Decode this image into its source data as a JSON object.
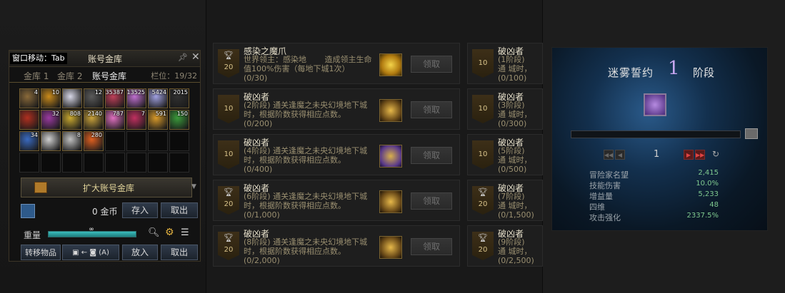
{
  "storage": {
    "move_tab": "窗口移动：Tab",
    "title": "账号金库",
    "pin_icon": "pin-icon",
    "tabs": [
      "金库 1",
      "金库 2",
      "账号金库"
    ],
    "active_tab": 2,
    "slots": "栏位：19/32",
    "items": [
      {
        "count": "4",
        "color": "#8a6a3a"
      },
      {
        "count": "10",
        "color": "#c98a1a"
      },
      {
        "count": "",
        "color": "#d6d6e6"
      },
      {
        "count": "12",
        "color": "#5a5a5a"
      },
      {
        "count": "35387",
        "color": "#c0405a"
      },
      {
        "count": "13525",
        "color": "#c070d0"
      },
      {
        "count": "5424",
        "color": "#a0a0e0"
      },
      {
        "count": "2015",
        "color": "#303030"
      },
      {
        "count": "",
        "color": "#b03020"
      },
      {
        "count": "32",
        "color": "#9a3aa0"
      },
      {
        "count": "808",
        "color": "#c8a830"
      },
      {
        "count": "2140",
        "color": "#c9a23a"
      },
      {
        "count": "787",
        "color": "#e070c0"
      },
      {
        "count": "7",
        "color": "#c03060"
      },
      {
        "count": "591",
        "color": "#d89a2a"
      },
      {
        "count": "150",
        "color": "#3a9a3a"
      },
      {
        "count": "34",
        "color": "#3a6ac0"
      },
      {
        "count": "",
        "color": "#d0d0d0"
      },
      {
        "count": "8",
        "color": "#c0c0c0"
      },
      {
        "count": "280",
        "color": "#e06020"
      }
    ],
    "expand_label": "扩大账号金库",
    "gold_text": "0 金币",
    "deposit": "存入",
    "withdraw": "取出",
    "weight_label": "重量",
    "weight_value": "∞",
    "weight_fill": 1.0,
    "transfer_label": "转移物品",
    "transfer_hint": "(A)",
    "put_in": "放入",
    "take_out": "取出"
  },
  "rows_left": [
    {
      "badge": "20",
      "trophy": true,
      "title": "感染之魔爪",
      "desc": "世界领主：感染地 　　造成领主生命值100%伤害（每地下城1次）",
      "progress": "(0/30)",
      "reward": "gold",
      "claim": "领取"
    },
    {
      "badge": "10",
      "trophy": false,
      "title": "破凶者",
      "desc": "(2阶段) 通关逢魔之未央幻境地下城时，根据阶数获得相应点数。",
      "progress": "(0/200)",
      "reward": "emblem",
      "claim": "领取"
    },
    {
      "badge": "10",
      "trophy": false,
      "title": "破凶者",
      "desc": "(4阶段) 通关逢魔之未央幻境地下城时，根据阶数获得相应点数。",
      "progress": "(0/400)",
      "reward": "emblem-purple",
      "claim": "领取"
    },
    {
      "badge": "20",
      "trophy": true,
      "title": "破凶者",
      "desc": "(6阶段) 通关逢魔之未央幻境地下城时，根据阶数获得相应点数。",
      "progress": "(0/1,000)",
      "reward": "emblem",
      "claim": "领取"
    },
    {
      "badge": "20",
      "trophy": true,
      "title": "破凶者",
      "desc": "(8阶段) 通关逢魔之未央幻境地下城时，根据阶数获得相应点数。",
      "progress": "(0/2,000)",
      "reward": "emblem",
      "claim": "领取"
    }
  ],
  "rows_right": [
    {
      "badge": "10",
      "trophy": false,
      "title": "破凶者",
      "desc": "(1阶段) 通 城时，根据",
      "progress": "(0/100)"
    },
    {
      "badge": "10",
      "trophy": false,
      "title": "破凶者",
      "desc": "(3阶段) 通 城时，根据",
      "progress": "(0/300)"
    },
    {
      "badge": "10",
      "trophy": false,
      "title": "破凶者",
      "desc": "(5阶段) 通 城时，根据",
      "progress": "(0/500)"
    },
    {
      "badge": "20",
      "trophy": true,
      "title": "破凶者",
      "desc": "(7阶段) 通 城时，根据",
      "progress": "(0/1,500)"
    },
    {
      "badge": "20",
      "trophy": true,
      "title": "破凶者",
      "desc": "(9阶段) 通 城时，根据",
      "progress": "(0/2,500)"
    }
  ],
  "oath": {
    "title": "迷雾誓约",
    "stage": "1",
    "stage_label": "阶段",
    "page": "1",
    "stats": [
      {
        "label": "冒险家名望",
        "value": "2,415"
      },
      {
        "label": "技能伤害",
        "value": "10.0%"
      },
      {
        "label": "增益量",
        "value": "5,233"
      },
      {
        "label": "四维",
        "value": "48"
      },
      {
        "label": "攻击强化",
        "value": "2337.5%"
      }
    ]
  }
}
